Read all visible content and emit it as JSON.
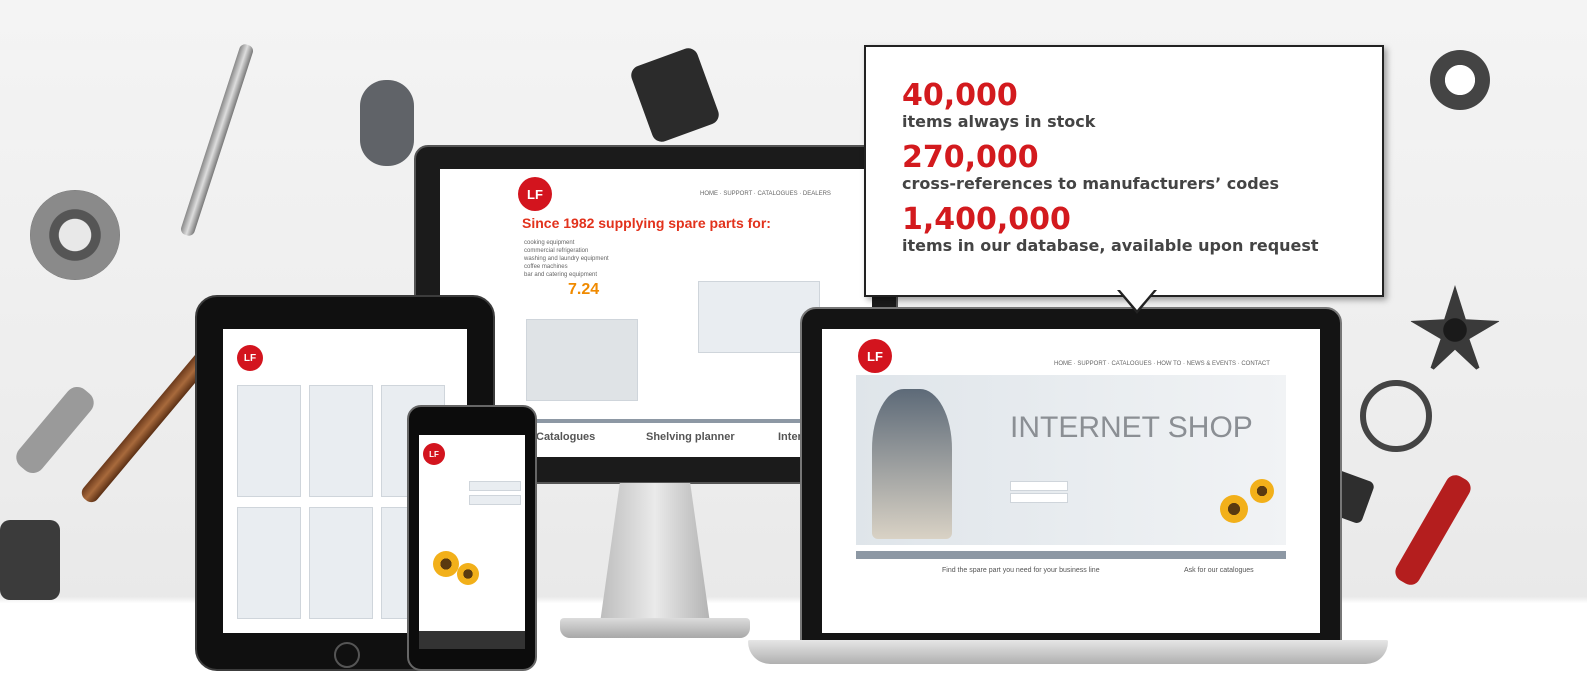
{
  "callout": {
    "stats": [
      {
        "number": "40,000",
        "text": "items always in stock"
      },
      {
        "number": "270,000",
        "text": "cross-references to manufacturers’ codes"
      },
      {
        "number": "1,400,000",
        "text": "items in our database, available upon request"
      }
    ]
  },
  "monitor_screen": {
    "logo": "LF",
    "tagline": "Since 1982 supplying spare parts for:",
    "price": "7.24",
    "panel_titles": [
      "Catalogues",
      "Shelving planner",
      "Internet sh"
    ]
  },
  "tablet_screen": {
    "logo": "LF"
  },
  "phone_screen": {
    "logo": "LF"
  },
  "laptop_screen": {
    "logo": "LF",
    "shop_title": "INTERNET SHOP",
    "bottom_heading_1": "Find the spare part you need for your business line",
    "bottom_heading_2": "Ask for our catalogues"
  },
  "colors": {
    "accent_red": "#d31a1e",
    "text_dark": "#444444"
  }
}
